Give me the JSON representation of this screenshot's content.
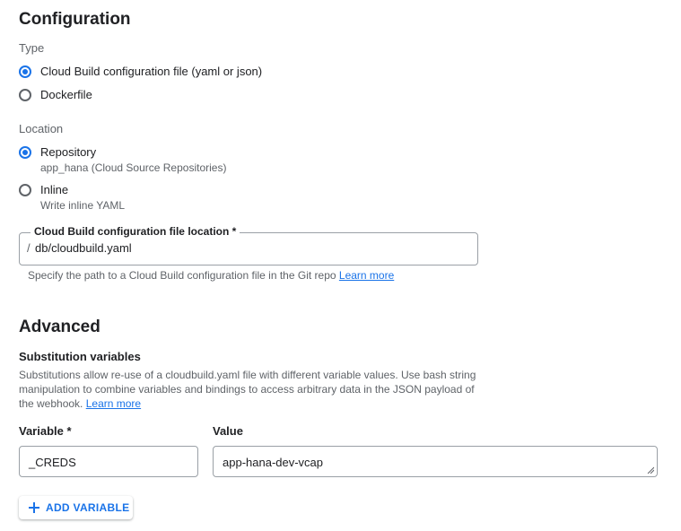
{
  "configuration": {
    "title": "Configuration",
    "type_label": "Type",
    "type_options": [
      {
        "label": "Cloud Build configuration file (yaml or json)",
        "selected": true
      },
      {
        "label": "Dockerfile",
        "selected": false
      }
    ],
    "location_label": "Location",
    "location_options": [
      {
        "label": "Repository",
        "sub": "app_hana (Cloud Source Repositories)",
        "selected": true
      },
      {
        "label": "Inline",
        "sub": "Write inline YAML",
        "selected": false
      }
    ],
    "file_location": {
      "label": "Cloud Build configuration file location *",
      "prefix": "/",
      "value": "db/cloudbuild.yaml",
      "helper": "Specify the path to a Cloud Build configuration file in the Git repo",
      "helper_link": "Learn more"
    }
  },
  "advanced": {
    "title": "Advanced",
    "subtitle": "Substitution variables",
    "description": "Substitutions allow re-use of a cloudbuild.yaml file with different variable values. Use bash string manipulation to combine variables and bindings to access arbitrary data in the JSON payload of the webhook.",
    "description_link": "Learn more",
    "variable_label": "Variable *",
    "value_label": "Value",
    "variables": [
      {
        "variable": "_CREDS",
        "value": "app-hana-dev-vcap"
      }
    ],
    "add_button": "ADD VARIABLE"
  },
  "colors": {
    "accent": "#1a73e8",
    "text": "#202124",
    "secondary_text": "#5f6368"
  }
}
